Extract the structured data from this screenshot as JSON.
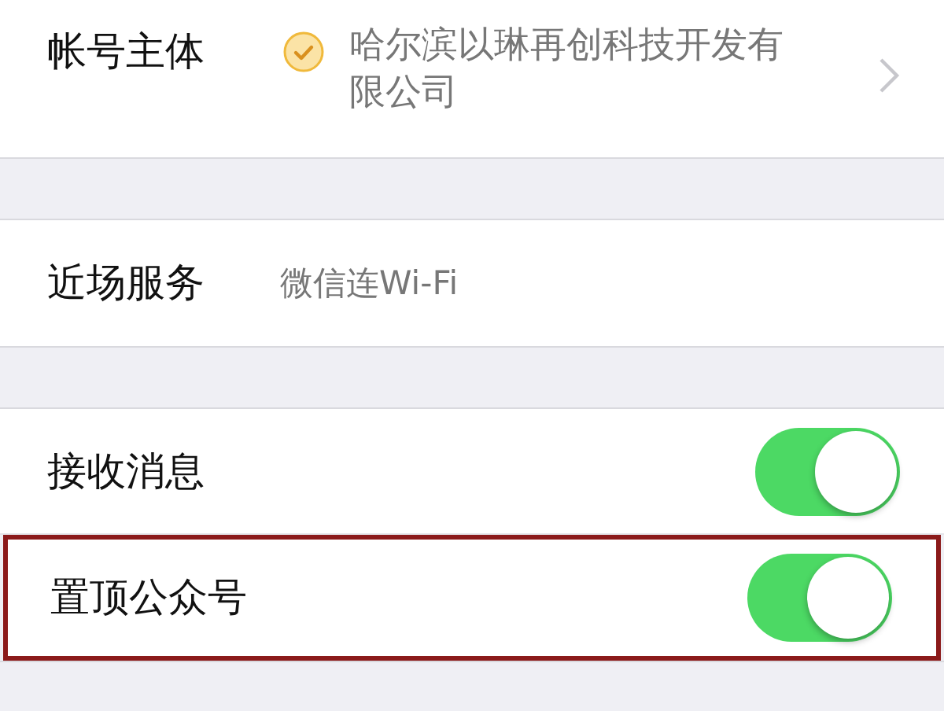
{
  "sections": [
    {
      "rows": [
        {
          "kind": "info",
          "label": "帐号主体",
          "verified": true,
          "value": "哈尔滨以琳再创科技开发有限公司",
          "chevron": true,
          "highlighted": false
        }
      ]
    },
    {
      "rows": [
        {
          "kind": "value",
          "label": "近场服务",
          "value": "微信连Wi-Fi",
          "highlighted": false
        }
      ]
    },
    {
      "rows": [
        {
          "kind": "toggle",
          "label": "接收消息",
          "on": true,
          "highlighted": false
        },
        {
          "kind": "toggle",
          "label": "置顶公众号",
          "on": true,
          "highlighted": true
        }
      ]
    }
  ]
}
